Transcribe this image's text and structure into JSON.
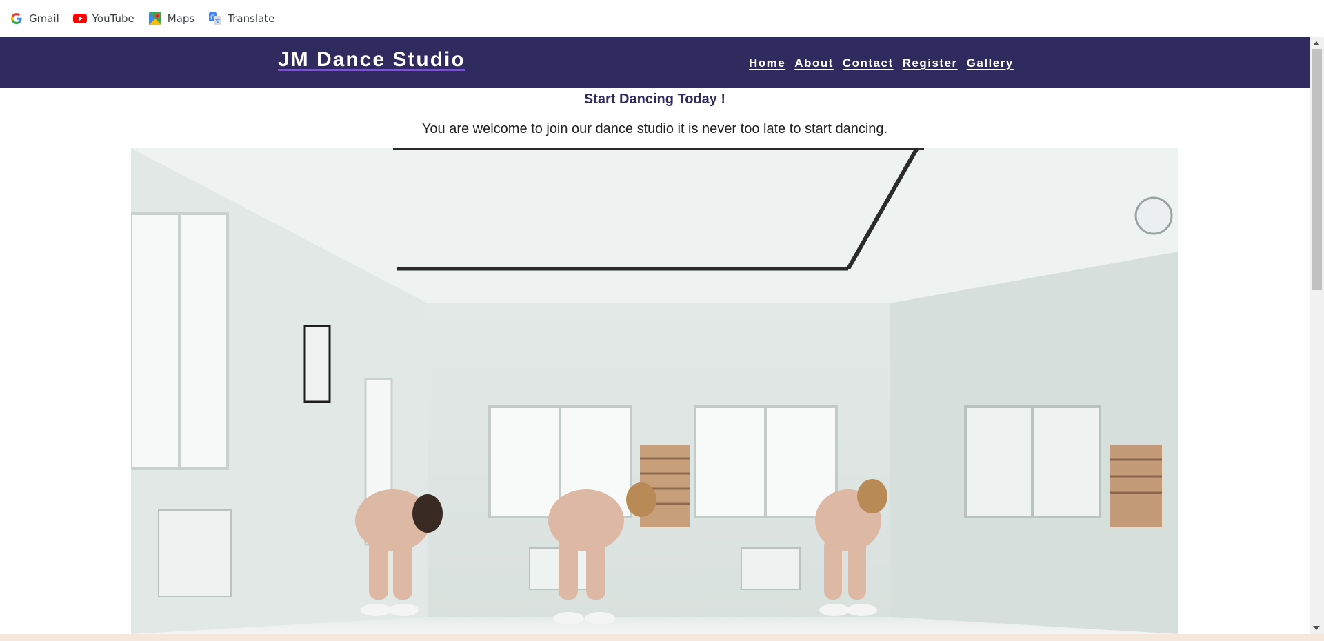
{
  "bookmarks": [
    {
      "label": "Gmail",
      "icon": "google-g-icon"
    },
    {
      "label": "YouTube",
      "icon": "youtube-icon"
    },
    {
      "label": "Maps",
      "icon": "maps-icon"
    },
    {
      "label": "Translate",
      "icon": "translate-icon"
    }
  ],
  "site": {
    "brand": "JM Dance Studio",
    "nav": [
      "Home",
      "About",
      "Contact",
      "Register",
      "Gallery"
    ]
  },
  "main": {
    "headline": "Start Dancing Today !",
    "subline": "You are welcome to join our dance studio it is never too late to start dancing."
  },
  "colors": {
    "navbar": "#2f2b5f",
    "headline": "#2f2b5f",
    "bookmark_text": "#3c4043",
    "bottom_strip": "#f6e7dc"
  }
}
